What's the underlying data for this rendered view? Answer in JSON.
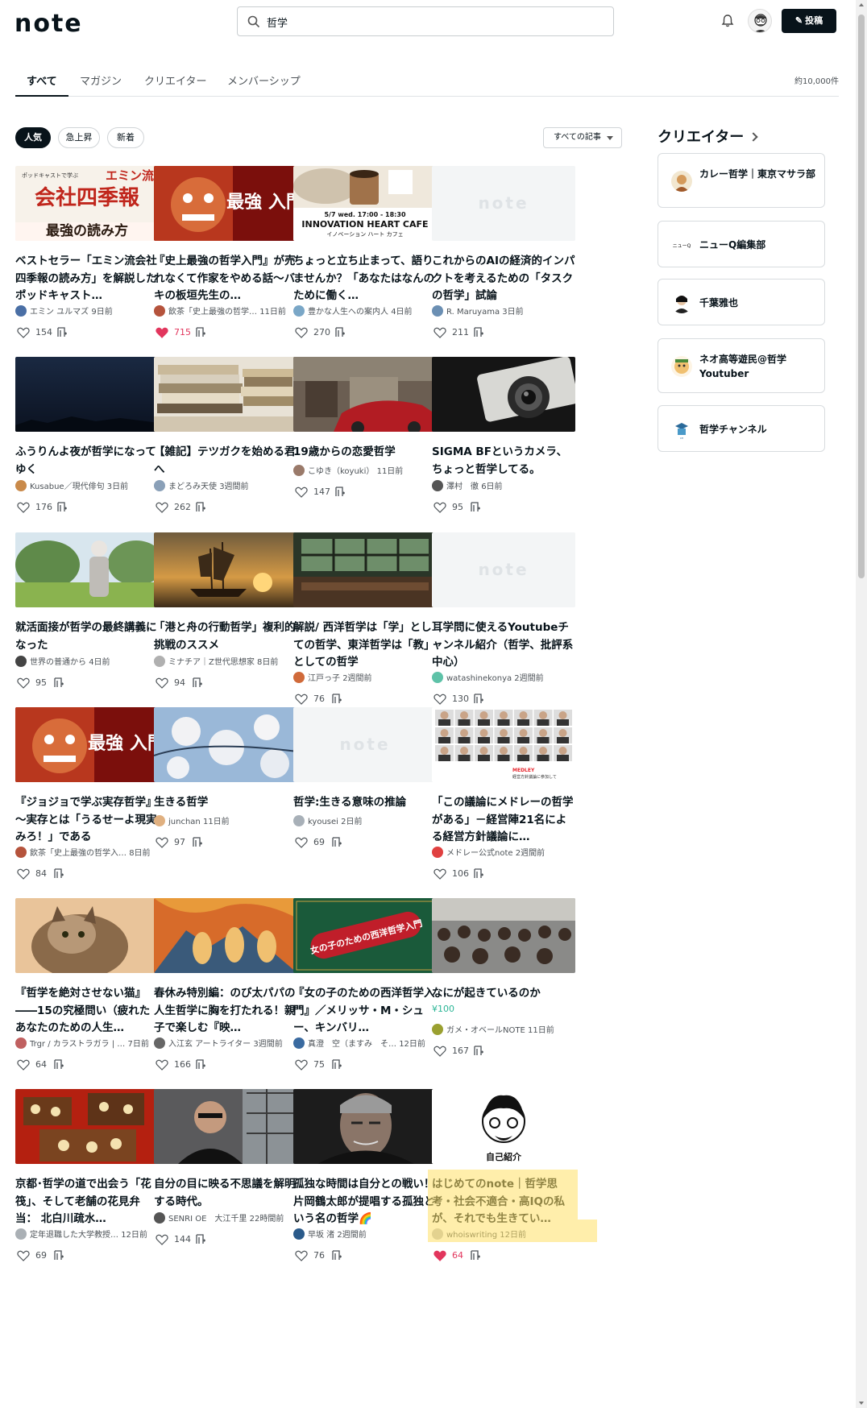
{
  "app": {
    "logo": "note"
  },
  "header": {
    "search_query": "哲学",
    "post_label": "投稿"
  },
  "tabs": [
    {
      "label": "すべて"
    },
    {
      "label": "マガジン"
    },
    {
      "label": "クリエイター"
    },
    {
      "label": "メンバーシップ"
    }
  ],
  "result_count": "約10,000件",
  "filters": {
    "chips": [
      {
        "label": "人気"
      },
      {
        "label": "急上昇"
      },
      {
        "label": "新着"
      }
    ],
    "sort": "すべての記事"
  },
  "articles": [
    {
      "title": "ベストセラー「エミン流会社四季報の読み方」を解説したポッドキャスト…",
      "author": "エミン ユルマズ",
      "time": "9日前",
      "likes": "154",
      "liked": false
    },
    {
      "title": "『史上最強の哲学入門』が売れなくて作家をやめる話～バキの板垣先生の…",
      "author": "飲茶「史上最強の哲学…",
      "time": "11日前",
      "likes": "715",
      "liked": true
    },
    {
      "title": "ちょっと立ち止まって、語りませんか？「あなたはなんのために働く…",
      "author": "豊かな人生への案内人",
      "time": "4日前",
      "likes": "270",
      "liked": false
    },
    {
      "title": "これからのAIの経済的インパクトを考えるための「タスクの哲学」試論",
      "author": "R. Maruyama",
      "time": "3日前",
      "likes": "211",
      "liked": false
    },
    {
      "title": "ふうりんよ夜が哲学になってゆく",
      "author": "Kusabue／現代俳句",
      "time": "3日前",
      "likes": "176",
      "liked": false
    },
    {
      "title": "【雑記】テツガクを始める君へ",
      "author": "まどろみ天使",
      "time": "3週間前",
      "likes": "262",
      "liked": false
    },
    {
      "title": "19歳からの恋愛哲学",
      "author": "こゆき（koyuki）",
      "time": "11日前",
      "likes": "147",
      "liked": false
    },
    {
      "title": "SIGMA BFというカメラ、ちょっと哲学してる。",
      "author": "澤村　徹",
      "time": "6日前",
      "likes": "95",
      "liked": false
    },
    {
      "title": "就活面接が哲学の最終講義になった",
      "author": "世界の普通から",
      "time": "4日前",
      "likes": "95",
      "liked": false
    },
    {
      "title": "「港と舟の行動哲学」複利的挑戦のススメ",
      "author": "ミナチア｜Z世代思想家",
      "time": "8日前",
      "likes": "94",
      "liked": false
    },
    {
      "title": "解説/ 西洋哲学は「学」としての哲学、東洋哲学は「教」としての哲学",
      "author": "江戸っ子",
      "time": "2週間前",
      "likes": "76",
      "liked": false
    },
    {
      "title": "耳学問に使えるYoutubeチャンネル紹介（哲学、批評系中心）",
      "author": "watashinekonya",
      "time": "2週間前",
      "likes": "130",
      "liked": false
    },
    {
      "title": "『ジョジョで学ぶ実存哲学』～実存とは「うるせーよ現実みろ！」である",
      "author": "飲茶「史上最強の哲学入…",
      "time": "8日前",
      "likes": "84",
      "liked": false
    },
    {
      "title": "生きる哲学",
      "author": "junchan",
      "time": "11日前",
      "likes": "97",
      "liked": false
    },
    {
      "title": "哲学:生きる意味の推論",
      "author": "kyousei",
      "time": "2日前",
      "likes": "69",
      "liked": false
    },
    {
      "title": "「この議論にメドレーの哲学がある」－経営陣21名による経営方針議論に…",
      "author": "メドレー公式note",
      "time": "2週間前",
      "likes": "106",
      "liked": false
    },
    {
      "title": "『哲学を絶対させない猫』――15の究極問い（疲れたあなたのための人生…",
      "author": "Trgr / カラストラガラ | …",
      "time": "7日前",
      "likes": "64",
      "liked": false
    },
    {
      "title": "春休み特別編：のび太パパの人生哲学に胸を打たれる！親子で楽しむ『映…",
      "author": "入江玄 アートライター",
      "time": "3週間前",
      "likes": "166",
      "liked": false
    },
    {
      "title": "『女の子のための西洋哲学入門』／メリッサ・M・シュー、キンバリ…",
      "author": "真澄　空（ますみ　そ…",
      "time": "12日前",
      "likes": "75",
      "liked": false
    },
    {
      "title": "なにが起きているのか",
      "price": "¥100",
      "author": "ガメ・オベールNOTE",
      "time": "11日前",
      "likes": "167",
      "liked": false
    },
    {
      "title": "京都･哲学の道で出会う「花筏」、そして老舗の花見弁当： 北白川疏水…",
      "author": "定年退職した大学教授…",
      "time": "12日前",
      "likes": "69",
      "liked": false
    },
    {
      "title": "自分の目に映る不思議を解明する時代。",
      "author": "SENRI OE　大江千里",
      "time": "22時間前",
      "likes": "144",
      "liked": false
    },
    {
      "title": "孤独な時間は自分との戦い！片岡鶴太郎が提唱する孤独という名の哲学🌈",
      "author": "早坂 渚",
      "time": "2週間前",
      "likes": "76",
      "liked": false
    },
    {
      "title": "はじめてのnote｜哲学思考・社会不適合・高IQの私が、それでも生きてい…",
      "author": "whoiswriting",
      "time": "12日前",
      "likes": "64",
      "liked": true
    }
  ],
  "thumbnails": {
    "t1": {
      "top": "ポッドキャストで学ぶ",
      "brand": "エミン流",
      "main": "会社四季報",
      "sub": "最強の読み方"
    },
    "t2": {
      "text": "最強 入門"
    },
    "t3": {
      "line1": "5/7 wed. 17:00 - 18:30",
      "line2": "INNOVATION HEART CAFE",
      "line3": "イノベーション ハート カフェ"
    },
    "t4": {
      "text": "note"
    },
    "t11": {
      "text": "note"
    },
    "t13": {
      "text": "最強 入門"
    },
    "t15": {
      "text": "note"
    },
    "t16": {
      "text": "MEDLEY",
      "sub": "経営方針議論に参加して"
    },
    "t19": {
      "text": "女の子のための西洋哲学入門"
    },
    "t24": {
      "text": "自己紹介"
    }
  },
  "sidebar": {
    "title": "クリエイター",
    "creators": [
      {
        "name": "カレー哲学｜東京マサラ部"
      },
      {
        "name": "ニューQ編集部",
        "logo": "ニューQ"
      },
      {
        "name": "千葉雅也"
      },
      {
        "name": "ネオ高等遊民@哲学Youtuber"
      },
      {
        "name": "哲学チャンネル"
      }
    ]
  },
  "colors": {
    "accent": "#08131a",
    "like_red": "#e2365d",
    "price_green": "#2cb696",
    "highlight": "#ffe066"
  }
}
